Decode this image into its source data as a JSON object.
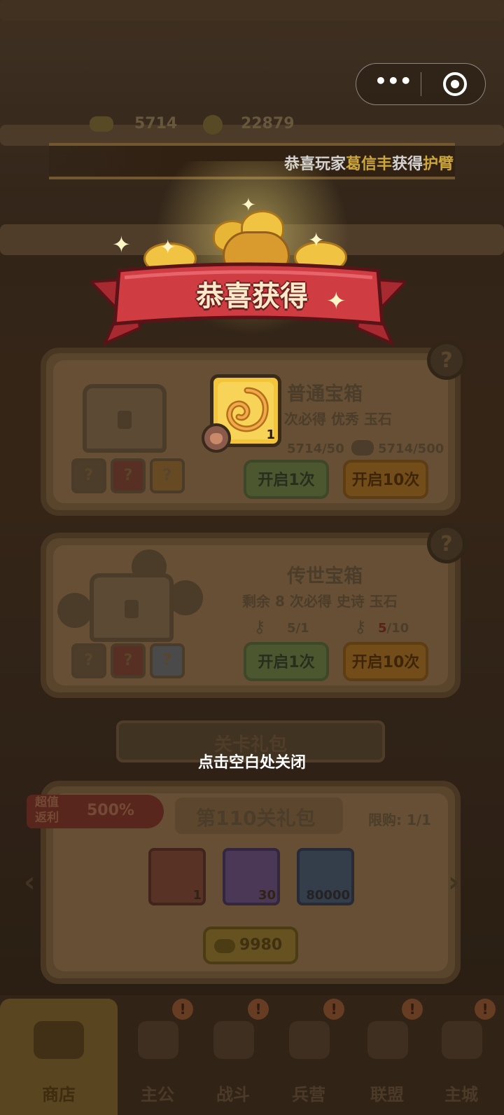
{
  "capsule": {
    "more_icon": "more-dots-icon",
    "close_icon": "target-circle-icon"
  },
  "resources": {
    "ingot_icon": "gold-ingot-icon",
    "ingot_value": "5714",
    "coin_icon": "copper-coin-icon",
    "coin_value": "22879"
  },
  "marquee": {
    "prefix": "恭喜玩家",
    "player": "葛信丰",
    "mid": "获得",
    "item": "护臂"
  },
  "shop": {
    "normal_chest": {
      "title": "普通宝箱",
      "desc_left": "次必得",
      "desc_quality": "优秀",
      "desc_right": "玉石",
      "cost_1": "5714/50",
      "cost_10": "5714/500",
      "btn_1": "开启1次",
      "btn_10": "开启10次"
    },
    "legend_chest": {
      "title": "传世宝箱",
      "desc_left": "剩余 8 次必得",
      "desc_quality": "史诗",
      "desc_right": "玉石",
      "cost_1": "5/1",
      "cost_10_a": "5",
      "cost_10_b": "/10",
      "btn_1": "开启1次",
      "btn_10": "开启10次"
    },
    "gift_header": "关卡礼包",
    "gift": {
      "badge_top": "超值",
      "badge_bottom": "返利",
      "badge_pct": "500%",
      "title": "第110关礼包",
      "limit": "限购: 1/1",
      "items": [
        {
          "icon": "armor-icon",
          "count": "1"
        },
        {
          "icon": "dragon-icon",
          "count": "30"
        },
        {
          "icon": "coin-icon",
          "count": "80000"
        }
      ],
      "price": "9980"
    }
  },
  "nav": [
    {
      "label": "商店",
      "icon": "shop-icon",
      "active": true
    },
    {
      "label": "主公",
      "icon": "lord-icon",
      "badge": "!"
    },
    {
      "label": "战斗",
      "icon": "battle-icon",
      "badge": "!"
    },
    {
      "label": "兵营",
      "icon": "barracks-icon",
      "badge": "!"
    },
    {
      "label": "联盟",
      "icon": "alliance-icon",
      "badge": "!"
    },
    {
      "label": "主城",
      "icon": "city-icon",
      "badge": "!"
    }
  ],
  "reward": {
    "banner_title": "恭喜获得",
    "item_icon": "jade-swirl-icon",
    "item_count": "1",
    "close_hint": "点击空白处关闭"
  },
  "colors": {
    "banner_red": "#cf3c42",
    "item_gold": "#f2c53a",
    "marquee_highlight": "#f6c84a"
  }
}
